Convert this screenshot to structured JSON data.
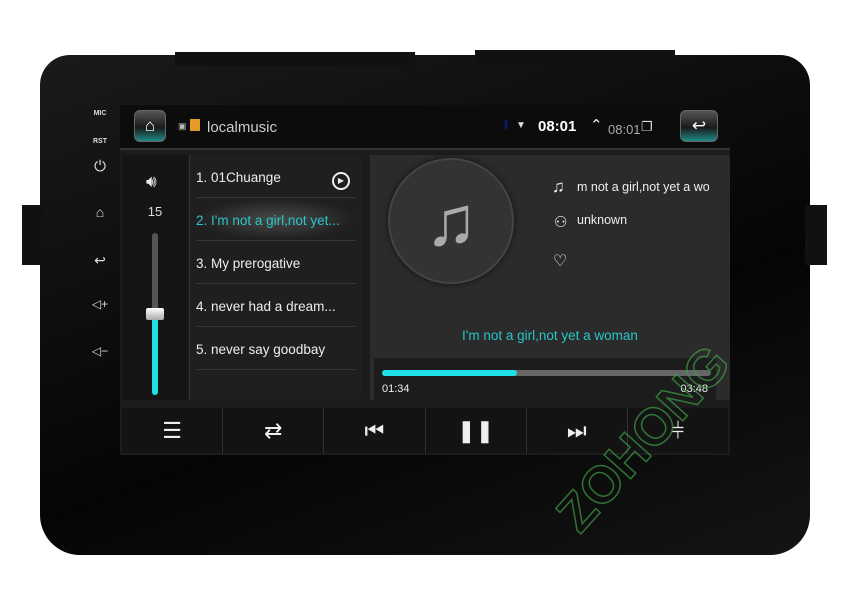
{
  "device": {
    "labels": {
      "mic": "MIC",
      "rst": "RST"
    },
    "watermark": "ZOHONG"
  },
  "status_bar": {
    "app_title": "localmusic",
    "clock": "08:01",
    "secondary_clock": "08:01"
  },
  "volume": {
    "level": "15",
    "fraction": 0.5
  },
  "playlist": {
    "items": [
      {
        "label": "1. 01Chuange",
        "active": false
      },
      {
        "label": "2. I'm not a girl,not yet...",
        "active": true
      },
      {
        "label": "3. My prerogative",
        "active": false
      },
      {
        "label": "4. never had a dream...",
        "active": false
      },
      {
        "label": "5. never say goodbay",
        "active": false
      }
    ]
  },
  "now_playing": {
    "title": "m not a girl,not yet a wo",
    "artist": "unknown",
    "lyric": "I'm not a girl,not yet a woman",
    "elapsed": "01:34",
    "duration": "03:48",
    "progress_fraction": 0.41
  },
  "controls": [
    "playlist",
    "repeat",
    "previous",
    "pause",
    "next",
    "equalizer"
  ],
  "colors": {
    "accent": "#29c5c8",
    "progress": "#1ee0e6"
  }
}
